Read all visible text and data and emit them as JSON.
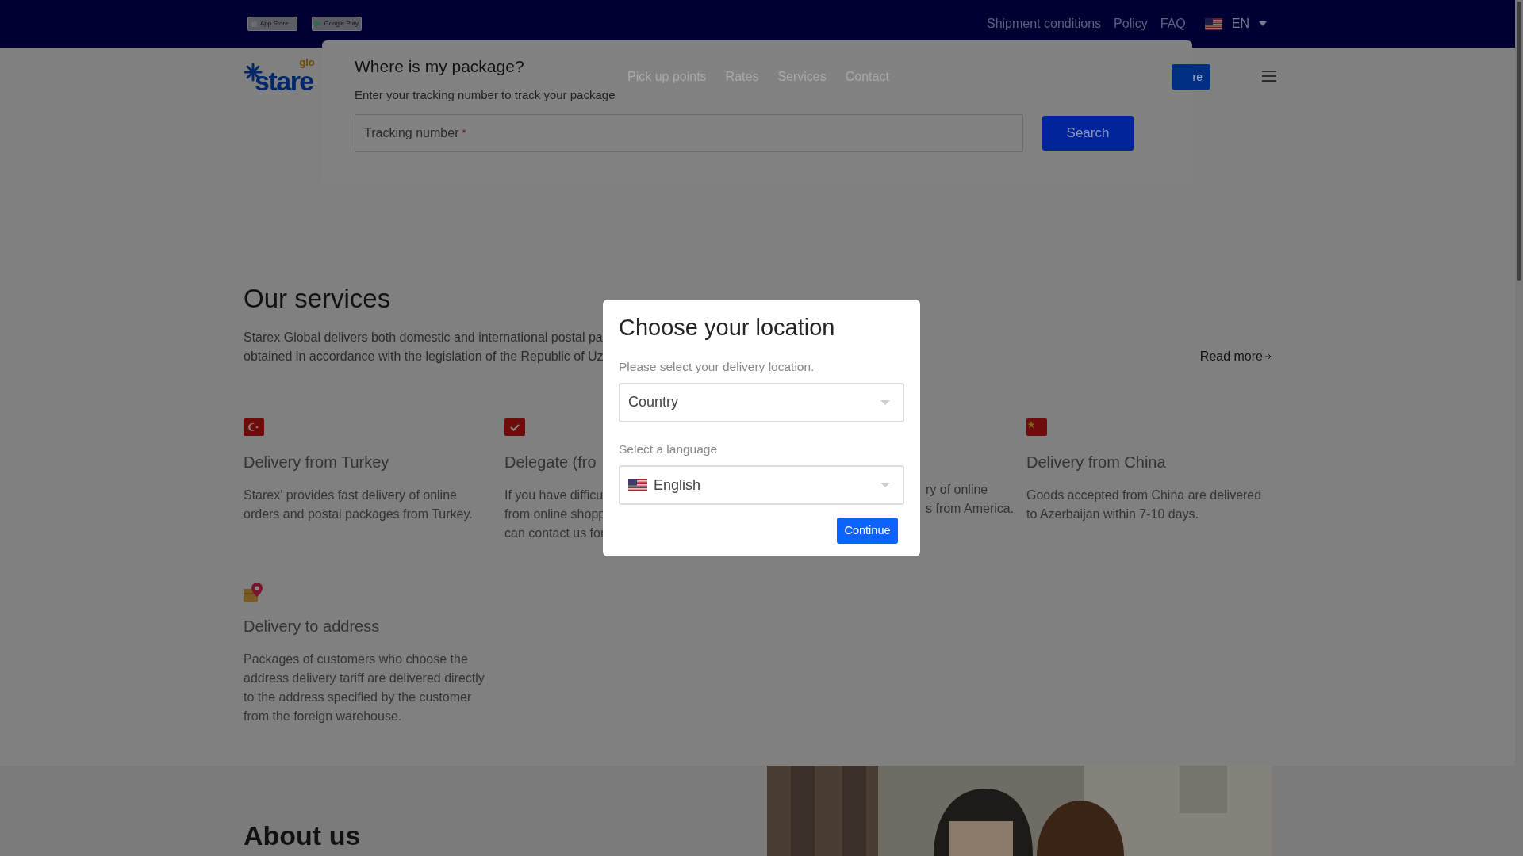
{
  "top_bar": {
    "badges": [
      {
        "kind": "apple",
        "label": "App Store"
      },
      {
        "kind": "google",
        "label": "Google Play"
      }
    ],
    "links": [
      "Shipment conditions",
      "Policy",
      "FAQ"
    ],
    "language": {
      "code": "EN"
    }
  },
  "nav": {
    "logo": {
      "text": "stare",
      "accent": "glo"
    },
    "links": [
      "Pick up points",
      "Rates",
      "Services",
      "Contact"
    ],
    "cta": "re"
  },
  "tracking": {
    "title": "Where is my package?",
    "subtitle": "Enter your tracking number to track your package",
    "placeholder": "Tracking number",
    "required_mark": "*",
    "button": "Search"
  },
  "services": {
    "title": "Our services",
    "intro": [
      "Starex Global delivers both domestic and international postal pa",
      "obtained in accordance with the legislation of the Republic of Uz"
    ],
    "read_more": "Read more",
    "items": [
      {
        "kind": "turkey",
        "title": "Delivery from Turkey",
        "description": "Starex' provides fast delivery of online orders and postal packages from Turkey."
      },
      {
        "kind": "delegate",
        "title": "Delegate (fro",
        "description": "If you have difficu\nfrom online shopp\ncan contact us for"
      },
      {
        "kind": "covered",
        "description": "ry of online\ns from America."
      },
      {
        "kind": "china",
        "title": "Delivery from China",
        "description": "Goods accepted from China are delivered to Azerbaijan within 7-10 days."
      },
      {
        "kind": "address",
        "title": "Delivery to address",
        "description": "Packages of customers who choose the address delivery tariff are delivered directly to the address specified by the customer from the foreign warehouse."
      }
    ]
  },
  "about": {
    "title": "About us"
  },
  "modal": {
    "title": "Choose your location",
    "location_label": "Please select your delivery location.",
    "country_placeholder": "Country",
    "language_label": "Select a language",
    "language_value": "English",
    "button": "Continue"
  }
}
